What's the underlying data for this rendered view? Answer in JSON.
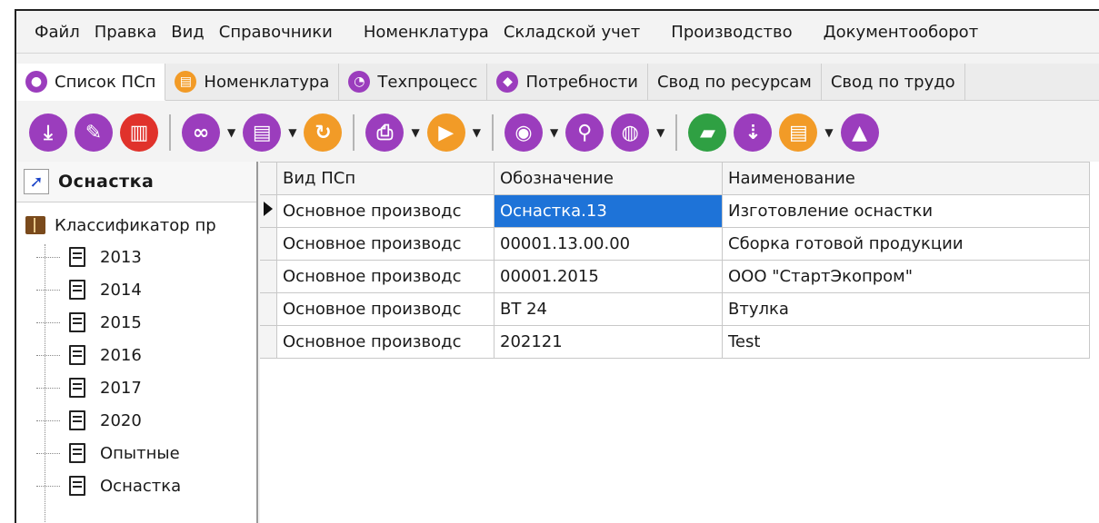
{
  "menu": [
    "Файл",
    "Правка",
    "Вид",
    "Справочники",
    "Номенклатура",
    "Складской учет",
    "Производство",
    "Документооборот"
  ],
  "tabs": [
    {
      "label": "Список ПСп",
      "icon": "list-icon",
      "color": "#9b3dbd",
      "active": true
    },
    {
      "label": "Номенклатура",
      "icon": "nomenclature-icon",
      "color": "#f29b27",
      "active": false
    },
    {
      "label": "Техпроцесс",
      "icon": "process-icon",
      "color": "#9b3dbd",
      "active": false
    },
    {
      "label": "Потребности",
      "icon": "tag-icon",
      "color": "#9b3dbd",
      "active": false
    },
    {
      "label": "Свод по ресурсам",
      "icon": "",
      "color": "",
      "active": false
    },
    {
      "label": "Свод по трудо",
      "icon": "",
      "color": "",
      "active": false
    }
  ],
  "toolbar": [
    {
      "name": "import-icon",
      "color": "#9b3dbd",
      "glyph": "⤓"
    },
    {
      "name": "edit-icon",
      "color": "#9b3dbd",
      "glyph": "✎"
    },
    {
      "name": "delete-icon",
      "color": "#e0322b",
      "glyph": "▥"
    },
    {
      "name": "link-icon",
      "color": "#9b3dbd",
      "glyph": "∞"
    },
    {
      "name": "document-icon",
      "color": "#9b3dbd",
      "glyph": "▤"
    },
    {
      "name": "refresh-icon",
      "color": "#f29b27",
      "glyph": "↻"
    },
    {
      "name": "print-icon",
      "color": "#9b3dbd",
      "glyph": "⎙"
    },
    {
      "name": "play-icon",
      "color": "#f29b27",
      "glyph": "▶"
    },
    {
      "name": "view-icon",
      "color": "#9b3dbd",
      "glyph": "◉"
    },
    {
      "name": "search-icon",
      "color": "#9b3dbd",
      "glyph": "⚲"
    },
    {
      "name": "globe-icon",
      "color": "#9b3dbd",
      "glyph": "◍"
    },
    {
      "name": "folder-open-icon",
      "color": "#2fa043",
      "glyph": "▰"
    },
    {
      "name": "download-icon",
      "color": "#9b3dbd",
      "glyph": "⇣"
    },
    {
      "name": "notes-icon",
      "color": "#f29b27",
      "glyph": "▤"
    },
    {
      "name": "graduate-icon",
      "color": "#9b3dbd",
      "glyph": "▲"
    }
  ],
  "left_panel": {
    "title": "Оснастка",
    "tree_root": "Классификатор пр",
    "items": [
      "2013",
      "2014",
      "2015",
      "2016",
      "2017",
      "2020",
      "Опытные",
      "Оснастка"
    ]
  },
  "grid": {
    "columns": [
      "Вид ПСп",
      "Обозначение",
      "Наименование"
    ],
    "rows": [
      [
        "Основное производс",
        "Оснастка.13",
        "Изготовление оснастки"
      ],
      [
        "Основное производс",
        "00001.13.00.00",
        "Сборка готовой продукции"
      ],
      [
        "Основное производс",
        "00001.2015",
        "ООО \"СтартЭкопром\""
      ],
      [
        "Основное производс",
        "ВТ 24",
        "Втулка"
      ],
      [
        "Основное производс",
        "202121",
        "Test"
      ]
    ],
    "selected_row": 0
  }
}
